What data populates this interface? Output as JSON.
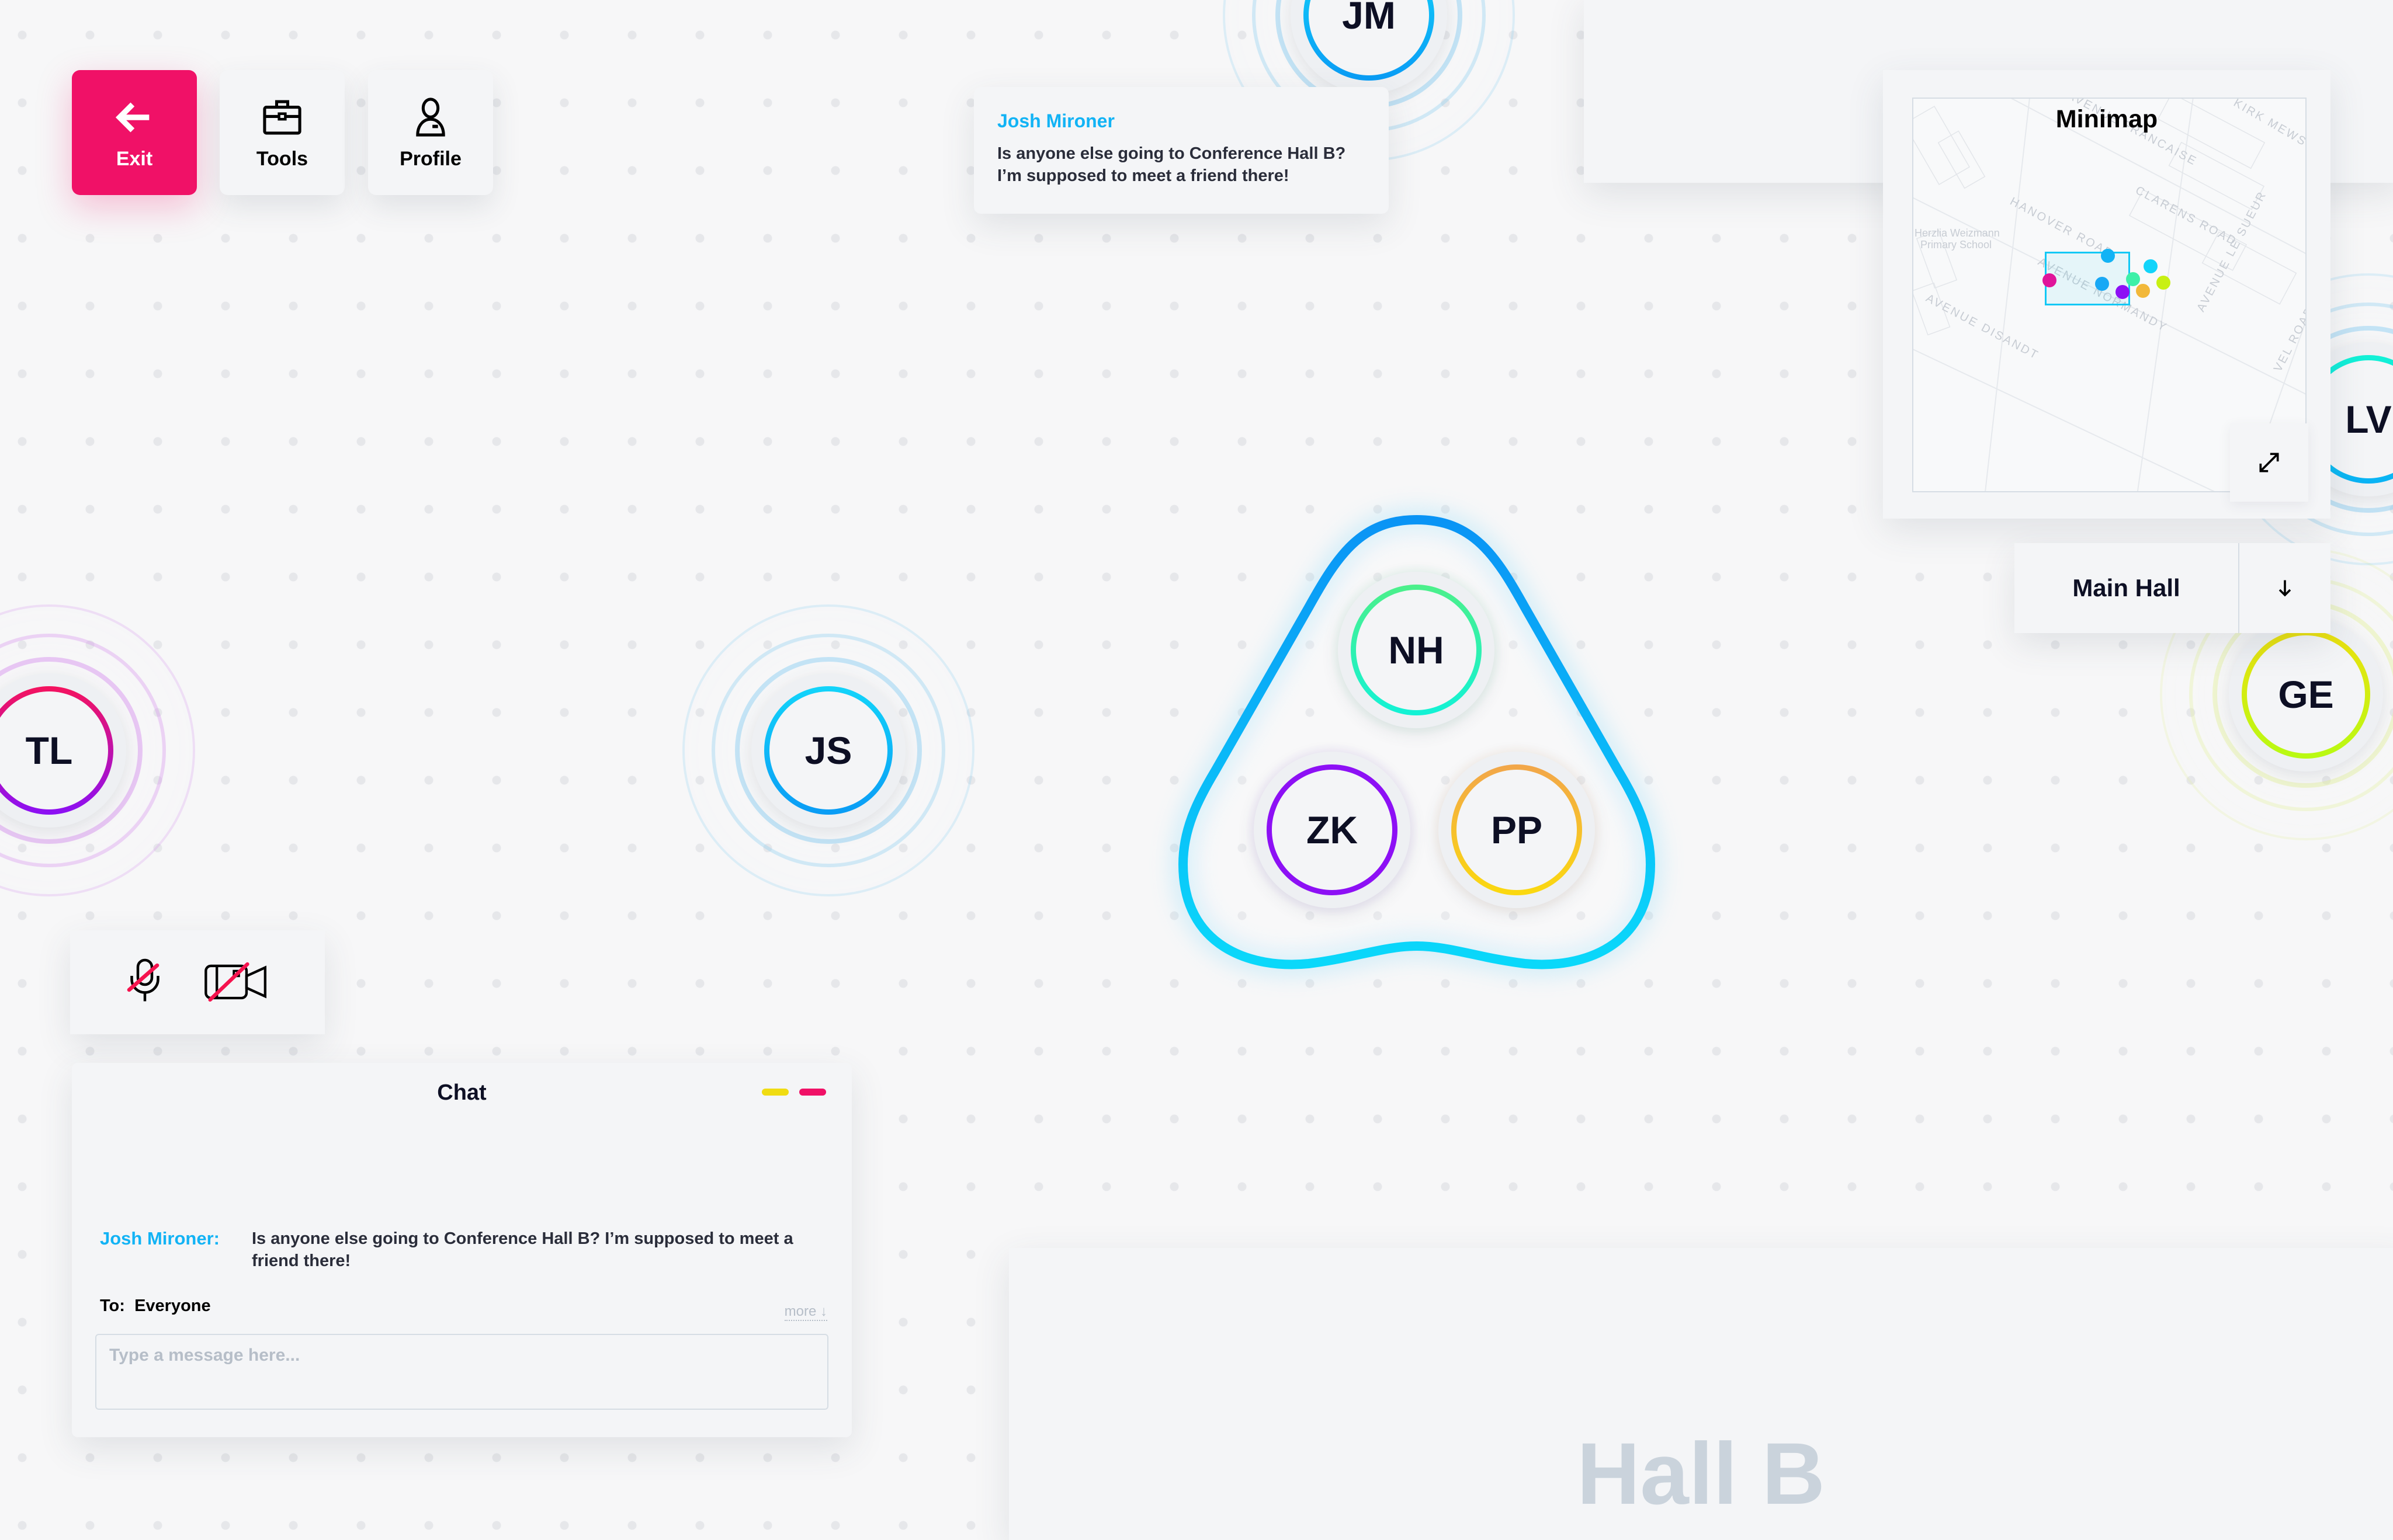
{
  "toolbar": {
    "exit_label": "Exit",
    "tools_label": "Tools",
    "profile_label": "Profile"
  },
  "speech_bubble": {
    "sender": "Josh Mironer",
    "message": "Is anyone else going to Conference Hall B? I’m supposed to meet a friend there!"
  },
  "avatars": [
    {
      "initials": "JM",
      "ring_colors": [
        "#12d4fa",
        "#0a9cf5"
      ],
      "halo": "#8fd0f2"
    },
    {
      "initials": "TL",
      "ring_colors": [
        "#f5135e",
        "#8b10f5"
      ],
      "halo": "#d795ee"
    },
    {
      "initials": "JS",
      "ring_colors": [
        "#12d4fa",
        "#0a9cf5"
      ],
      "halo": "#8fd0f2"
    },
    {
      "initials": "NH",
      "ring_colors": [
        "#4cf08a",
        "#12f2d6"
      ],
      "halo": "#a6e9c6"
    },
    {
      "initials": "ZK",
      "ring_colors": [
        "#8d10f5",
        "#8d10f5"
      ],
      "halo": "#c8a6f0"
    },
    {
      "initials": "PP",
      "ring_colors": [
        "#f2a64a",
        "#fbd90f"
      ],
      "halo": "#f7d2b0"
    },
    {
      "initials": "GE",
      "ring_colors": [
        "#ece010",
        "#b8fa12"
      ],
      "halo": "#e6f2a6"
    },
    {
      "initials": "LV",
      "ring_colors": [
        "#12f2d6",
        "#0ab2f5"
      ],
      "halo": "#8fd0f2"
    }
  ],
  "group_bubble": {
    "members": [
      "NH",
      "ZK",
      "PP"
    ],
    "stroke_colors": [
      "#0a94f5",
      "#0ad8fa"
    ]
  },
  "minimap": {
    "title": "Minimap",
    "labels": [
      "AVENUE FRANCAISE",
      "KIRK MEWS",
      "HANOVER ROAD",
      "CLARENS ROAD",
      "AVENUE NORMANDY",
      "AVENUE LE SUEUR",
      "AVENUE DISANDT",
      "VEL ROAD",
      "Herzlia Weizmann",
      "Primary School"
    ],
    "viewport_color": "#12c8f5",
    "dots": [
      "#12b3f5",
      "#12d4fa",
      "#e0149a",
      "#18a8f5",
      "#3df0a8",
      "#8d10f5",
      "#f2b83a",
      "#c8f012"
    ],
    "expand_icon": "expand-diagonal-icon"
  },
  "hall_selector": {
    "selected": "Main Hall",
    "arrow_icon": "arrow-down-icon"
  },
  "media": {
    "mic_icon": "mic-muted-icon",
    "camera_icon": "camera-off-icon",
    "mute_color": "#f5134e"
  },
  "chat": {
    "title": "Chat",
    "minimize_color": "#f0dc12",
    "close_color": "#f01167",
    "messages": [
      {
        "sender": "Josh Mironer:",
        "text": "Is anyone else going to Conference Hall B?  I’m supposed to meet a friend there!"
      }
    ],
    "to_label": "To:",
    "to_value": "Everyone",
    "more_label": "more ↓",
    "input_placeholder": "Type a message here..."
  },
  "rooms": {
    "hall_b_label": "Hall B"
  },
  "colors": {
    "accent": "#f01167",
    "link": "#12b3f5",
    "background": "#f7f7f8"
  }
}
